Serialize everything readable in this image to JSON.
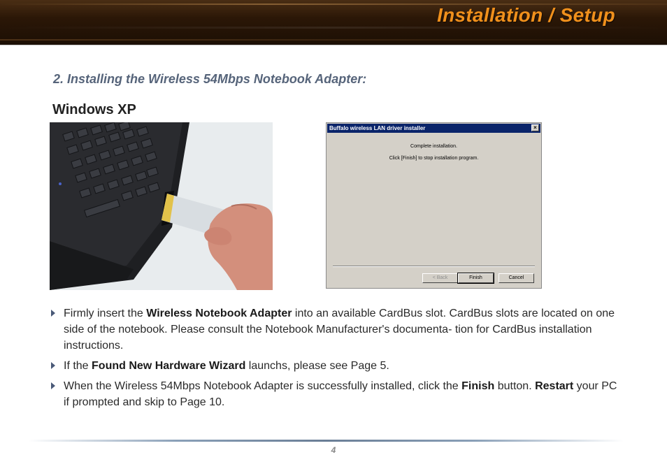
{
  "header": {
    "title": "Installation / Setup"
  },
  "section": {
    "heading": "2. Installing the Wireless 54Mbps Notebook Adapter:"
  },
  "os_label": "Windows XP",
  "dialog": {
    "title": "Buffalo wireless LAN driver installer",
    "close_label": "×",
    "message_line1": "Complete installation.",
    "message_line2": "Click [Finish] to stop installation program.",
    "back_label": "< Back",
    "finish_label": "Finish",
    "cancel_label": "Cancel"
  },
  "bullets": [
    {
      "parts": [
        "Firmly insert the ",
        "Wireless Notebook Adapter",
        " into an available CardBus slot. CardBus slots are located on one side of the notebook.  Please consult the Notebook Manufacturer's documenta- tion for CardBus installation instructions."
      ]
    },
    {
      "parts": [
        "If the ",
        "Found New Hardware Wizard",
        " launchs, please see Page 5."
      ]
    },
    {
      "parts": [
        "When the Wireless 54Mbps Notebook Adapter is successfully installed, click the ",
        "Finish",
        " button. ",
        "Restart",
        " your PC if prompted and skip to Page 10."
      ]
    }
  ],
  "footer": {
    "page_number": "4"
  },
  "colors": {
    "header_title": "#f0901c",
    "section_heading": "#56647a",
    "bullet_marker": "#4a5a78"
  }
}
